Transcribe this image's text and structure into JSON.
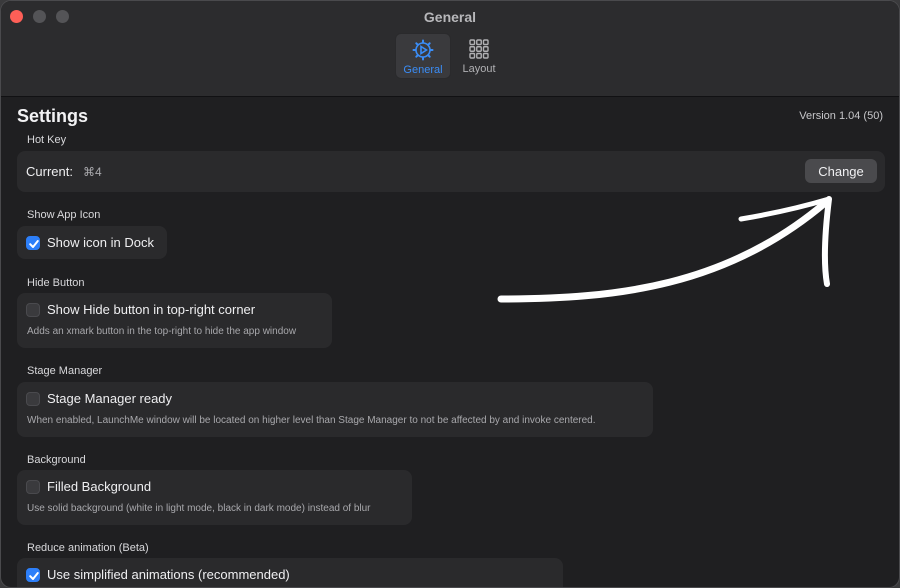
{
  "window": {
    "title": "General",
    "tabs": [
      {
        "label": "General",
        "icon": "gear-icon",
        "selected": true
      },
      {
        "label": "Layout",
        "icon": "grid-icon",
        "selected": false
      }
    ]
  },
  "header": {
    "title": "Settings",
    "version": "Version 1.04 (50)"
  },
  "hotkey": {
    "section": "Hot Key",
    "current_label": "Current:",
    "current_value": "⌘4",
    "change_label": "Change"
  },
  "app_icon": {
    "section": "Show App Icon",
    "option": "Show icon in Dock",
    "checked": true
  },
  "hide_button": {
    "section": "Hide Button",
    "option": "Show Hide button in top-right corner",
    "description": "Adds an xmark button in the top-right to hide the app window",
    "checked": false
  },
  "stage_manager": {
    "section": "Stage Manager",
    "option": "Stage Manager ready",
    "description": "When enabled, LaunchMe window will be located on higher level than Stage Manager to not be affected by and invoke centered.",
    "checked": false
  },
  "background": {
    "section": "Background",
    "option": "Filled Background",
    "description": "Use solid background (white in light mode, black in dark mode) instead of blur",
    "checked": false
  },
  "animation": {
    "section": "Reduce animation (Beta)",
    "option": "Use simplified animations (recommended)",
    "checked": true
  },
  "colors": {
    "accent": "#2d7ff9",
    "window_bg": "#1f1f21",
    "group_bg": "#2a2a2c",
    "close": "#fe5f57"
  }
}
